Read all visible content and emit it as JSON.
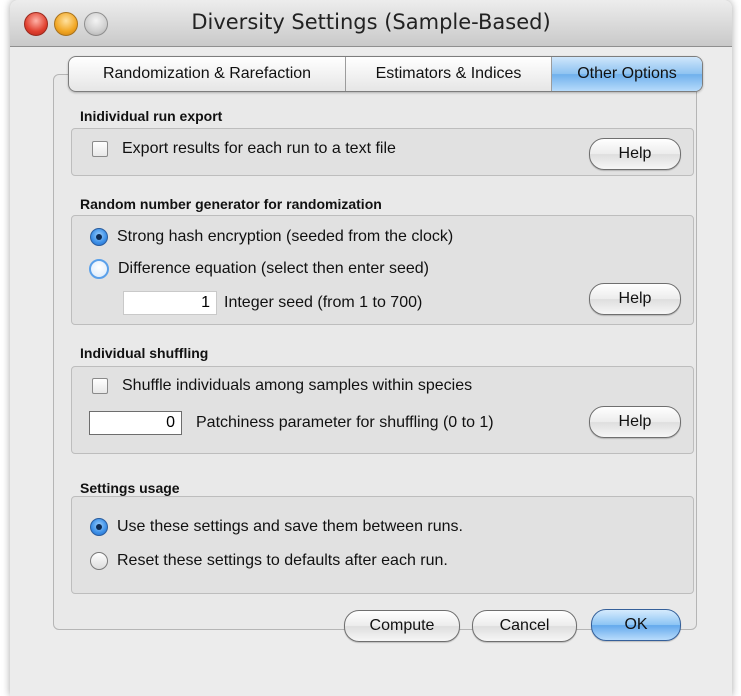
{
  "window": {
    "title": "Diversity Settings (Sample-Based)"
  },
  "tabs": [
    {
      "label": "Randomization & Rarefaction"
    },
    {
      "label": "Estimators & Indices"
    },
    {
      "label": "Other Options"
    }
  ],
  "export": {
    "title": "Inidividual run export",
    "checkbox_label": "Export results for each run to a text file",
    "help_label": "Help"
  },
  "rng": {
    "title": "Random number generator for randomization",
    "option_hash": "Strong hash encryption (seeded from the clock)",
    "option_difference": "Difference equation (select then enter seed)",
    "seed_value": "1",
    "seed_label": "Integer seed (from 1 to 700)",
    "help_label": "Help"
  },
  "shuffling": {
    "title": "Individual shuffling",
    "checkbox_label": "Shuffle individuals among samples within species",
    "patchiness_value": "0",
    "patchiness_label": "Patchiness parameter for shuffling (0 to 1)",
    "help_label": "Help"
  },
  "usage": {
    "title": "Settings usage",
    "option_save": "Use these settings and save them between runs.",
    "option_reset": "Reset these settings to defaults after each run."
  },
  "footer": {
    "compute_label": "Compute",
    "cancel_label": "Cancel",
    "ok_label": "OK"
  }
}
